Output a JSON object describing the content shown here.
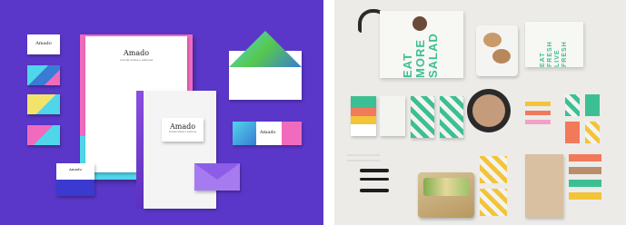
{
  "left_photo": {
    "subject": "brand stationery mockup",
    "background_color": "#5a37c9",
    "brand_name": "Amado",
    "tagline": "Comida criativa e saborosa"
  },
  "right_photo": {
    "subject": "salad restaurant packaging mockup",
    "background_color": "#ecebe8",
    "bag_text": [
      "EAT",
      "MORE",
      "SALAD"
    ],
    "bag2_text": [
      "EAT FRESH",
      "LIVE FRESH"
    ]
  },
  "colors": {
    "purple": "#5a37c9",
    "pink": "#f06bbd",
    "cyan": "#4fd6ea",
    "green": "#3dbf94",
    "yellow": "#f2c43a",
    "orange": "#f2795a"
  }
}
